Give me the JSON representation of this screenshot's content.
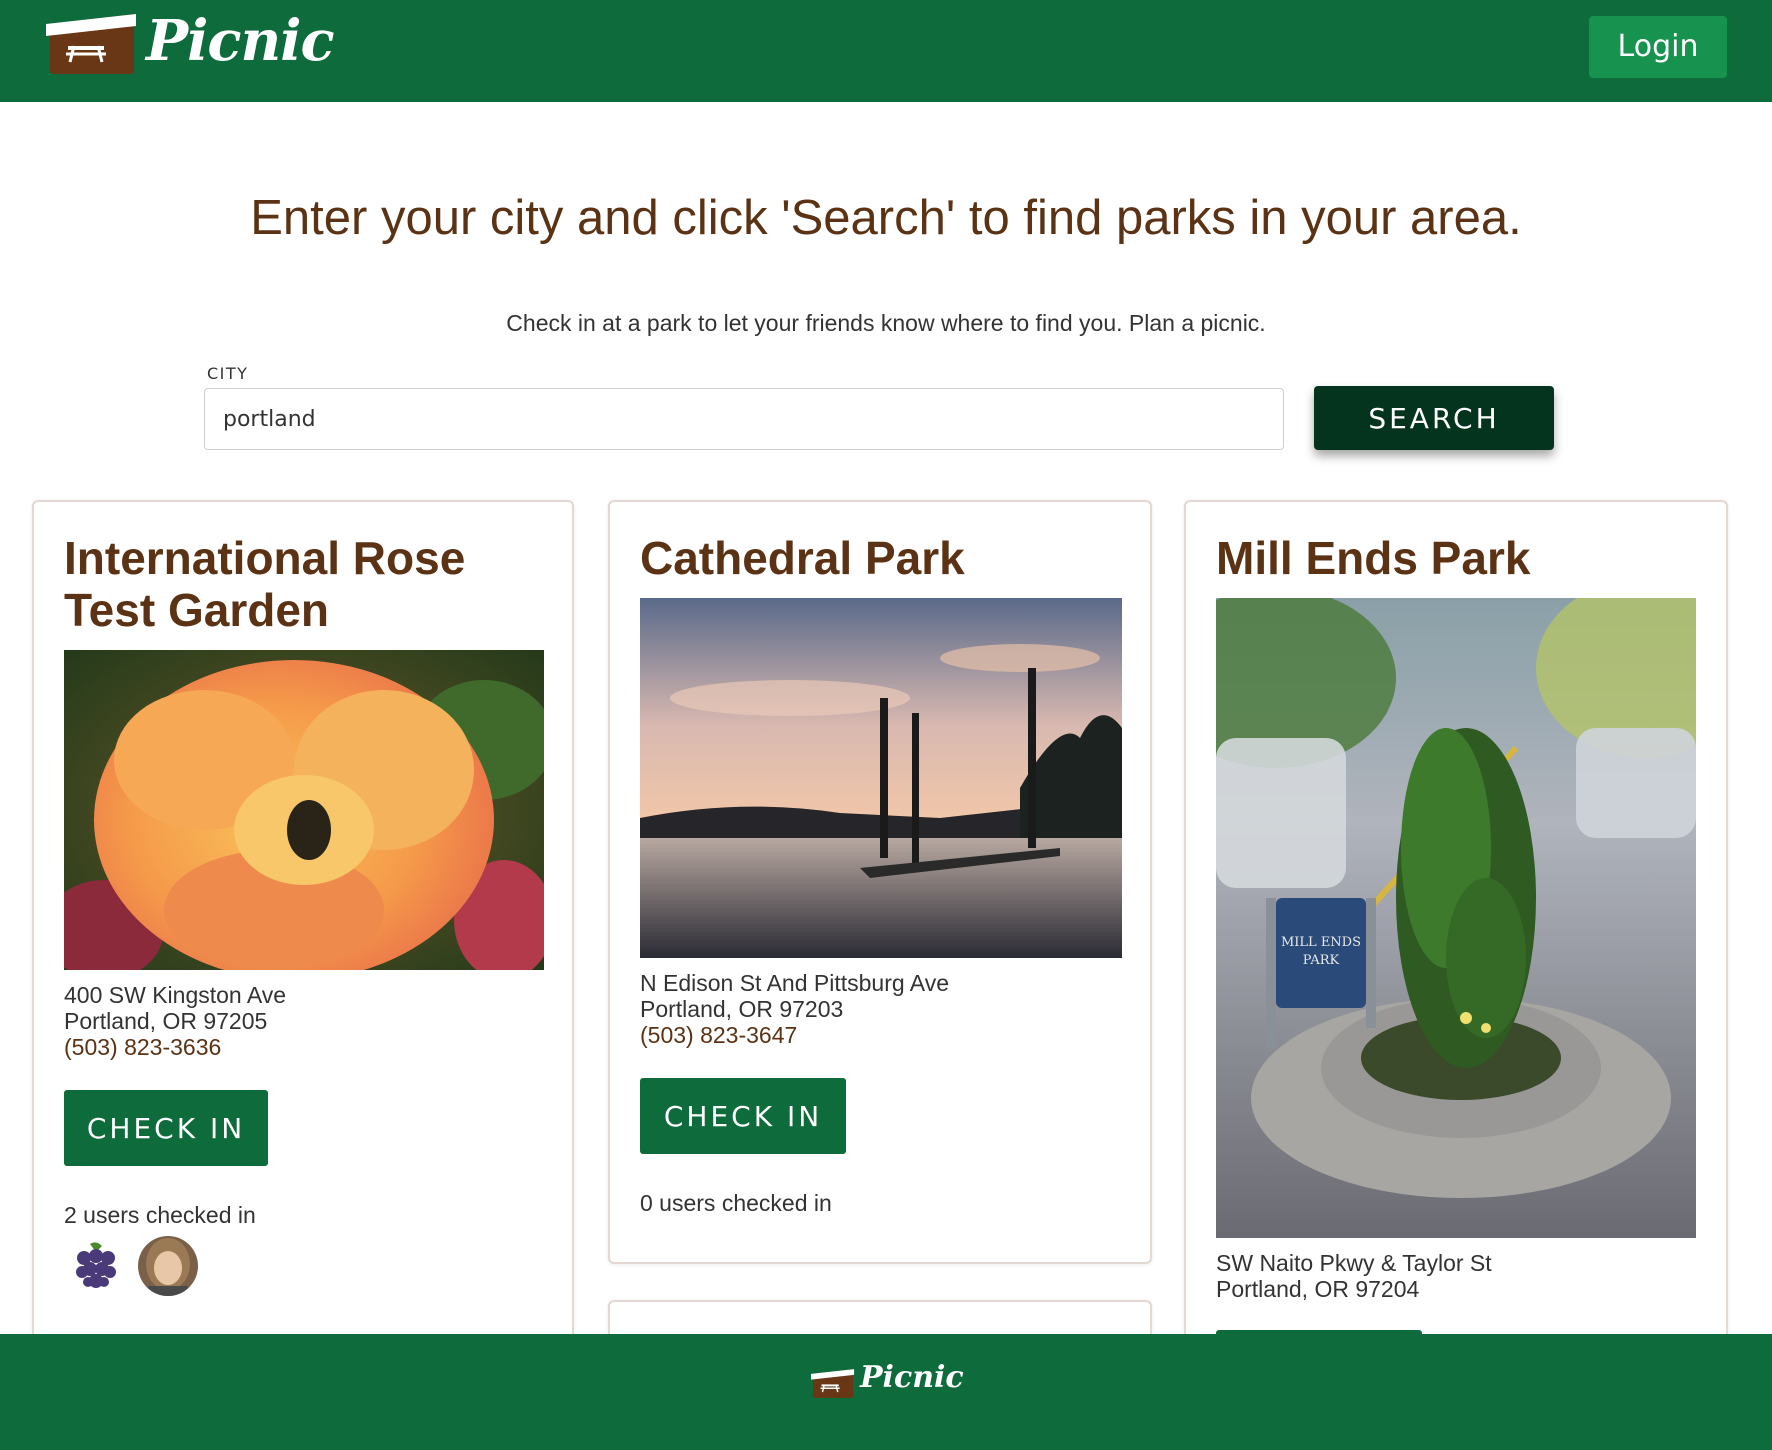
{
  "header": {
    "brand": "Picnic",
    "login_label": "Login"
  },
  "intro": {
    "headline": "Enter your city and click 'Search' to find parks in your area.",
    "subline": "Check in at a park to let your friends know where to find you. Plan a picnic."
  },
  "search": {
    "city_label": "CITY",
    "city_value": "portland",
    "button_label": "SEARCH"
  },
  "parks": [
    {
      "name": "International Rose Test Garden",
      "address_line1": "400 SW Kingston Ave",
      "address_line2": "Portland, OR 97205",
      "phone": "(503) 823-3636",
      "checkin_label": "CHECK IN",
      "users_checked_in": "2 users checked in",
      "users": [
        "grapes-avatar",
        "woman-avatar"
      ]
    },
    {
      "name": "Cathedral Park",
      "address_line1": "N Edison St And Pittsburg Ave",
      "address_line2": "Portland, OR 97203",
      "phone": "(503) 823-3647",
      "checkin_label": "CHECK IN",
      "users_checked_in": "0 users checked in"
    },
    {
      "name": "Mill Ends Park",
      "address_line1": "SW Naito Pkwy & Taylor St",
      "address_line2": "Portland, OR 97204",
      "sign_text": "MILL ENDS PARK"
    }
  ],
  "footer": {
    "brand": "Picnic"
  },
  "colors": {
    "brand_green": "#0d6b3c",
    "login_green": "#17924f",
    "search_dark": "#05341e",
    "title_brown": "#5b3214"
  }
}
